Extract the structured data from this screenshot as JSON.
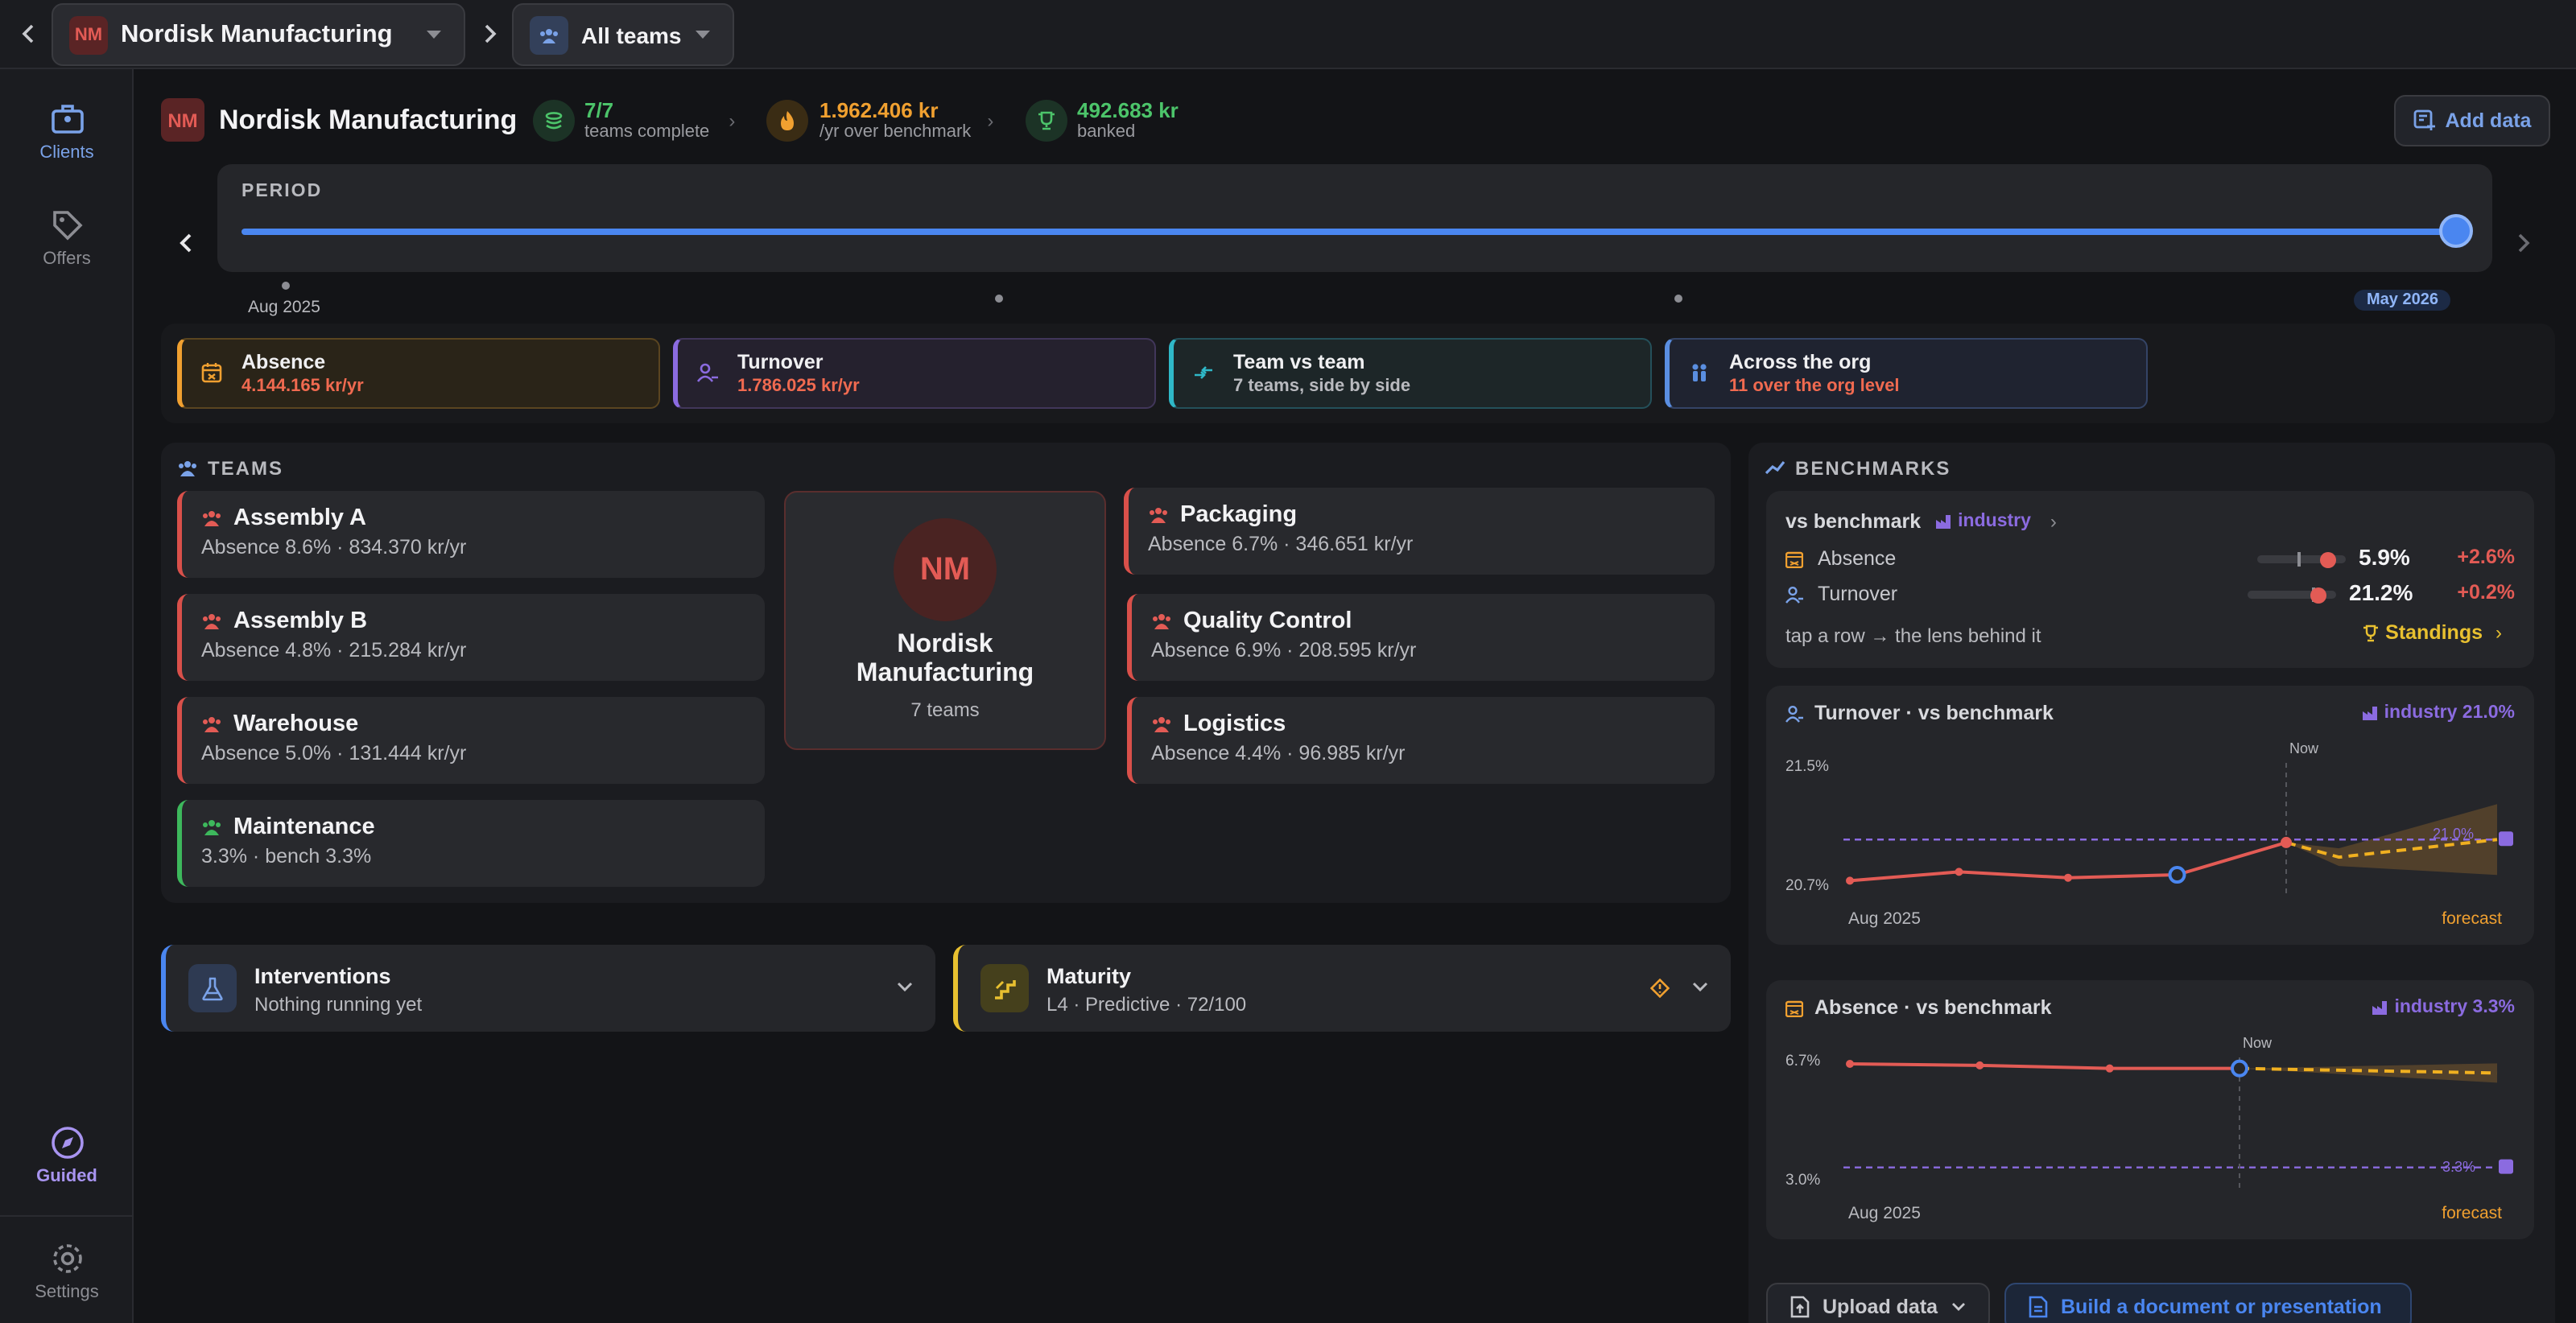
{
  "topbar": {
    "org_initials": "NM",
    "org_name": "Nordisk Manufacturing",
    "teams_filter": "All teams"
  },
  "sidebar": {
    "items": [
      {
        "label": "Clients",
        "icon": "briefcase-icon",
        "active": true
      },
      {
        "label": "Offers",
        "icon": "tag-icon",
        "active": false
      },
      {
        "label": "Guided",
        "icon": "compass-icon",
        "active": true
      },
      {
        "label": "Settings",
        "icon": "gear-icon",
        "active": false
      }
    ]
  },
  "header": {
    "org_initials": "NM",
    "org_name": "Nordisk Manufacturing",
    "stats": [
      {
        "value": "7/7",
        "label": "teams complete",
        "color": "#4cc46a"
      },
      {
        "value": "1.962.406 kr",
        "label": "/yr over benchmark",
        "color": "#f0a030"
      },
      {
        "value": "492.683 kr",
        "label": "banked",
        "color": "#4cc46a"
      }
    ],
    "add_data": "Add data"
  },
  "period": {
    "label": "PERIOD",
    "start": "Aug 2025",
    "end": "May 2026",
    "position": 1.0
  },
  "lenses": [
    {
      "title": "Absence",
      "sub": "4.144.165 kr/yr",
      "color": "#f0a030",
      "sub_color": "#f06a50"
    },
    {
      "title": "Turnover",
      "sub": "1.786.025 kr/yr",
      "color": "#8b6be0",
      "sub_color": "#f06a50"
    },
    {
      "title": "Team vs team",
      "sub": "7 teams, side by side",
      "color": "#2fb8c8",
      "sub_color": "#b9babf"
    },
    {
      "title": "Across the org",
      "sub": "11 over the org level",
      "color": "#5a8ee0",
      "sub_color": "#f06a50"
    }
  ],
  "teams": {
    "title": "TEAMS",
    "left": [
      {
        "name": "Assembly A",
        "stat": "Absence 8.6% · 834.370 kr/yr",
        "status": "red"
      },
      {
        "name": "Assembly B",
        "stat": "Absence 4.8% · 215.284 kr/yr",
        "status": "red"
      },
      {
        "name": "Warehouse",
        "stat": "Absence 5.0% · 131.444 kr/yr",
        "status": "red"
      },
      {
        "name": "Maintenance",
        "stat": "3.3% · bench 3.3%",
        "status": "green"
      }
    ],
    "right": [
      {
        "name": "Packaging",
        "stat": "Absence 6.7% · 346.651 kr/yr",
        "status": "red"
      },
      {
        "name": "Quality Control",
        "stat": "Absence 6.9% · 208.595 kr/yr",
        "status": "red"
      },
      {
        "name": "Logistics",
        "stat": "Absence 4.4% · 96.985 kr/yr",
        "status": "red"
      }
    ],
    "center": {
      "initials": "NM",
      "name": "Nordisk Manufacturing",
      "count": "7 teams"
    }
  },
  "panels": {
    "interventions": {
      "title": "Interventions",
      "sub": "Nothing running yet"
    },
    "maturity": {
      "title": "Maturity",
      "sub": "L4 · Predictive · 72/100"
    }
  },
  "benchmarks": {
    "title": "BENCHMARKS",
    "vs_label": "vs benchmark",
    "source": "industry",
    "rows": [
      {
        "name": "Absence",
        "value": "5.9%",
        "delta": "+2.6%",
        "fill": 0.8
      },
      {
        "name": "Turnover",
        "value": "21.2%",
        "delta": "+0.2%",
        "fill": 0.8
      }
    ],
    "hint": "tap a row → the lens behind it",
    "standings": "Standings"
  },
  "charts": {
    "turnover": {
      "title": "Turnover · vs benchmark",
      "bench_label": "industry 21.0%",
      "now_label": "Now",
      "x_label": "Aug 2025",
      "forecast_label": "forecast",
      "ref_label": "21.0%",
      "y_top_label": "21.5%",
      "y_bottom_label": "20.7%"
    },
    "absence": {
      "title": "Absence · vs benchmark",
      "bench_label": "industry 3.3%",
      "now_label": "Now",
      "x_label": "Aug 2025",
      "forecast_label": "forecast",
      "ref_label": "3.3%",
      "y_top_label": "6.7%",
      "y_bottom_label": "3.0%"
    }
  },
  "chart_data": [
    {
      "type": "line",
      "title": "Turnover · vs benchmark",
      "ylim": [
        20.7,
        21.5
      ],
      "benchmark": 21.0,
      "series": [
        {
          "name": "",
          "values": [
            20.72,
            20.78,
            20.74,
            20.76,
            20.98
          ]
        },
        {
          "name": "forecast",
          "values": [
            20.98,
            20.88,
            20.92,
            20.96,
            21.0
          ]
        }
      ]
    },
    {
      "type": "line",
      "title": "Absence · vs benchmark",
      "ylim": [
        3.0,
        6.7
      ],
      "benchmark": 3.3,
      "series": [
        {
          "name": "",
          "values": [
            6.7,
            6.65,
            6.55,
            6.55
          ]
        },
        {
          "name": "forecast",
          "values": [
            6.55,
            6.5,
            6.45,
            6.4
          ]
        }
      ]
    }
  ],
  "footer": {
    "upload": "Upload data",
    "build": "Build a document or presentation"
  }
}
